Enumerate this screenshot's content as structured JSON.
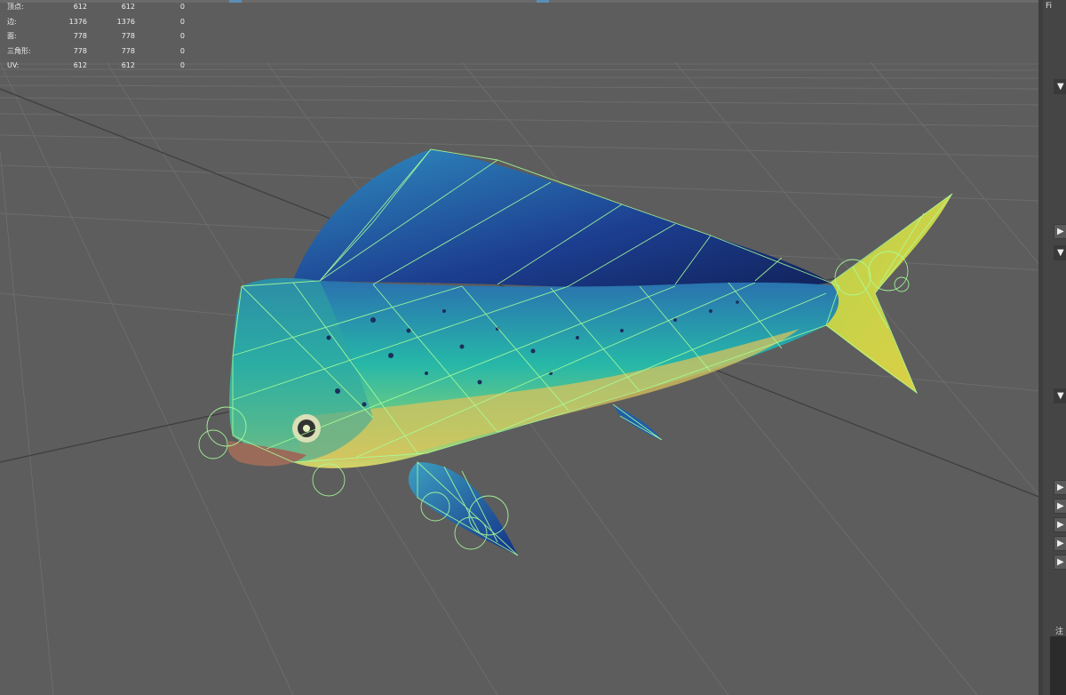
{
  "hud": {
    "rows": [
      {
        "label": "顶点:",
        "c1": "612",
        "c2": "612",
        "c3": "0"
      },
      {
        "label": "边:",
        "c1": "1376",
        "c2": "1376",
        "c3": "0"
      },
      {
        "label": "面:",
        "c1": "778",
        "c2": "778",
        "c3": "0"
      },
      {
        "label": "三角形:",
        "c1": "778",
        "c2": "778",
        "c3": "0"
      },
      {
        "label": "UV:",
        "c1": "612",
        "c2": "612",
        "c3": "0"
      }
    ]
  },
  "panel": {
    "title": "Fi",
    "footer_label": "注",
    "toggles": [
      {
        "icon": "dropdown-arrow-icon",
        "glyph": "▼"
      },
      {
        "icon": "play-arrow-icon",
        "glyph": "▶"
      },
      {
        "icon": "dropdown-arrow-icon",
        "glyph": "▼"
      },
      {
        "icon": "dropdown-arrow-icon",
        "glyph": "▼"
      },
      {
        "icon": "expand-arrow-icon",
        "glyph": "▶"
      },
      {
        "icon": "expand-arrow-icon",
        "glyph": "▶"
      },
      {
        "icon": "expand-arrow-icon",
        "glyph": "▶"
      },
      {
        "icon": "expand-arrow-icon",
        "glyph": "▶"
      },
      {
        "icon": "expand-arrow-icon",
        "glyph": "▶"
      }
    ]
  },
  "colors": {
    "viewport_bg": "#5d5d5d",
    "grid": "#6f6f6f",
    "wire": "#a8ff9a",
    "fish_blue": "#1a3f8a",
    "fish_teal": "#23b5a0",
    "fish_yellow": "#d8d24a"
  }
}
